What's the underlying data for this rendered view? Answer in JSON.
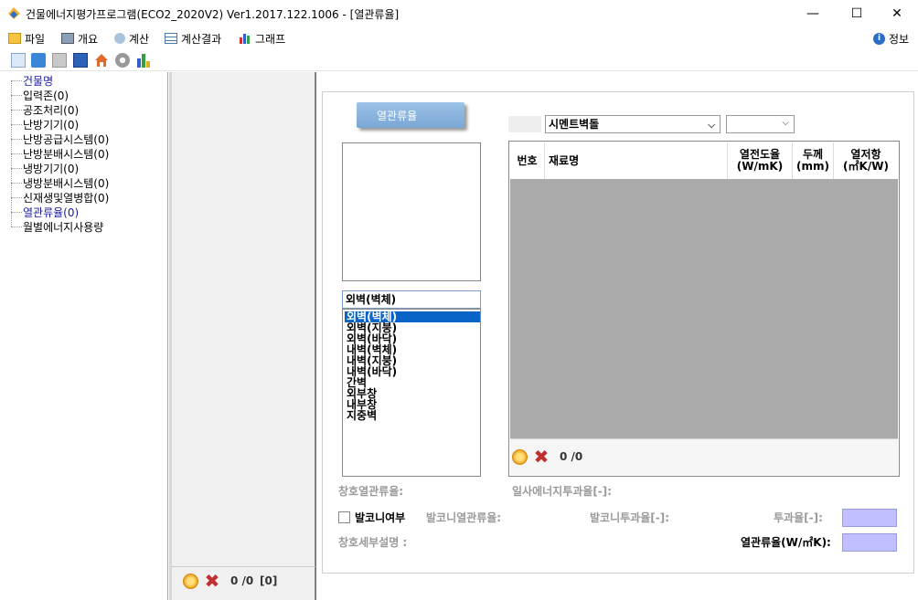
{
  "window": {
    "title": "건물에너지평가프로그램(ECO2_2020V2) Ver1.2017.122.1006 - [열관류율]",
    "minimize": "—",
    "maximize": "☐",
    "close": "✕"
  },
  "menu": {
    "items": [
      {
        "label": "파일",
        "icon": "folder-icon"
      },
      {
        "label": "개요",
        "icon": "building-icon"
      },
      {
        "label": "계산",
        "icon": "gear-icon"
      },
      {
        "label": "계산결과",
        "icon": "table-icon"
      },
      {
        "label": "그래프",
        "icon": "chart-icon"
      }
    ],
    "info_label": "정보"
  },
  "toolbar": {
    "icons": [
      "new-file-icon",
      "open-folder-icon",
      "save-disabled-icon",
      "save-icon",
      "home-icon",
      "settings-icon",
      "chart-icon"
    ]
  },
  "tree": {
    "items": [
      {
        "label": "건물명",
        "selected": true
      },
      {
        "label": "입력존(0)"
      },
      {
        "label": "공조처리(0)"
      },
      {
        "label": "난방기기(0)"
      },
      {
        "label": "난방공급시스템(0)"
      },
      {
        "label": "난방분배시스템(0)"
      },
      {
        "label": "냉방기기(0)"
      },
      {
        "label": "냉방분배시스템(0)"
      },
      {
        "label": "신재생및열병합(0)"
      },
      {
        "label": "열관류율(0)",
        "selected": true
      },
      {
        "label": "월별에너지사용량"
      }
    ]
  },
  "mid_panel": {
    "count": "0 /0",
    "count_bracket": "[0]"
  },
  "main": {
    "tab_label": "열관류율",
    "material_combo": "시멘트벽돌",
    "third_combo": "",
    "type_combo": "외벽(벽체)",
    "type_list": [
      "외벽(벽체)",
      "외벽(지붕)",
      "외벽(바닥)",
      "내벽(벽체)",
      "내벽(지붕)",
      "내벽(바닥)",
      "간벽",
      "외부창",
      "내부창",
      "지중벽"
    ],
    "grid_headers": {
      "no": "번호",
      "name": "재료명",
      "conductivity": "열전도율\n(W/mK)",
      "thickness": "두께\n(mm)",
      "resistance": "열저항\n(㎡K/W)"
    },
    "grid_count": "0 /0",
    "window_u_label": "창호열관류율:",
    "solar_label": "일사에너지투과율[-]:",
    "balcony_label": "발코니여부",
    "balcony_u_label": "발코니열관류율:",
    "balcony_trans_label": "발코니투과율[-]:",
    "trans_label": "투과율[-]:",
    "window_desc_label": "창호세부설명 :",
    "u_value_label": "열관류율(W/㎡K):",
    "trans_value": "",
    "u_value": ""
  },
  "colors": {
    "accent": "#0a64c8",
    "grid_bg": "#aaaaaa",
    "highlight_field": "#c0c0ff"
  }
}
